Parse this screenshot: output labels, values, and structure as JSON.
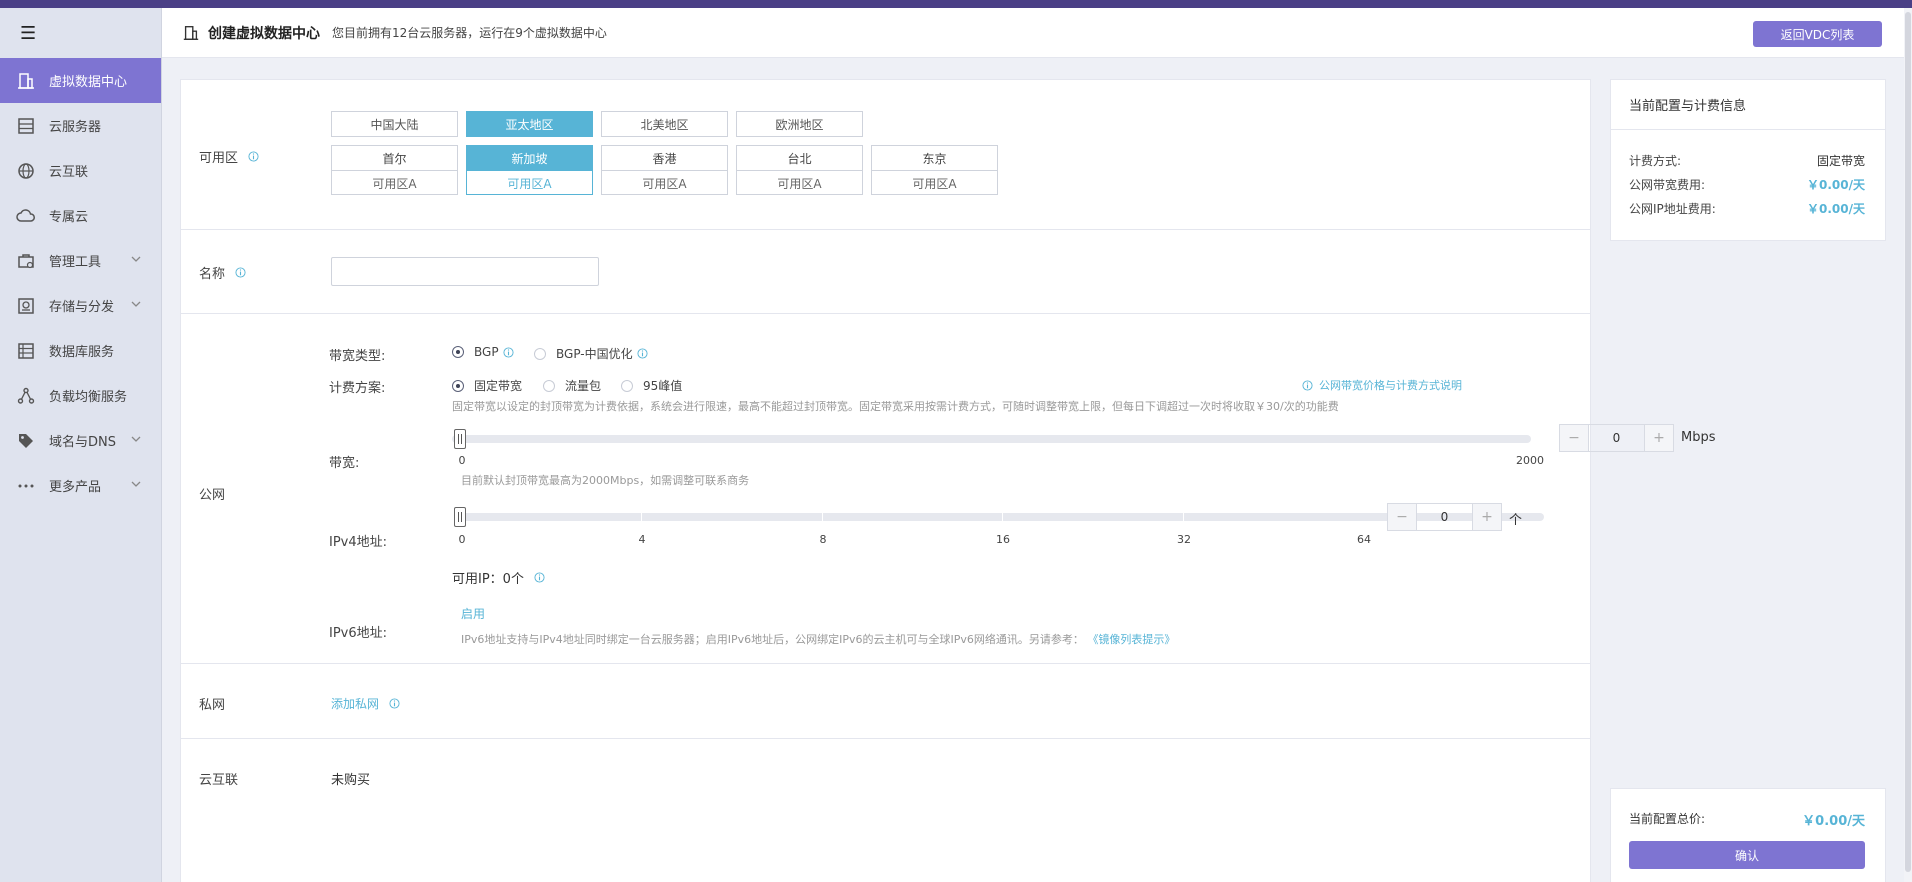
{
  "sidebar": {
    "items": [
      {
        "label": "虚拟数据中心",
        "icon": "building-icon"
      },
      {
        "label": "云服务器",
        "icon": "server-icon"
      },
      {
        "label": "云互联",
        "icon": "globe-icon"
      },
      {
        "label": "专属云",
        "icon": "cloud-icon"
      },
      {
        "label": "管理工具",
        "icon": "toolbox-icon"
      },
      {
        "label": "存储与分发",
        "icon": "storage-icon"
      },
      {
        "label": "数据库服务",
        "icon": "database-icon"
      },
      {
        "label": "负载均衡服务",
        "icon": "network-icon"
      },
      {
        "label": "域名与DNS",
        "icon": "tag-icon"
      },
      {
        "label": "更多产品",
        "icon": "more-icon"
      }
    ]
  },
  "header": {
    "title": "创建虚拟数据中心",
    "subtitle": "您目前拥有12台云服务器，运行在9个虚拟数据中心",
    "back_button": "返回VDC列表"
  },
  "zone": {
    "label": "可用区",
    "regions": [
      "中国大陆",
      "亚太地区",
      "北美地区",
      "欧洲地区"
    ],
    "active_region": "亚太地区",
    "cities": [
      {
        "city": "首尔",
        "az": "可用区A"
      },
      {
        "city": "新加坡",
        "az": "可用区A"
      },
      {
        "city": "香港",
        "az": "可用区A"
      },
      {
        "city": "台北",
        "az": "可用区A"
      },
      {
        "city": "东京",
        "az": "可用区A"
      }
    ],
    "active_city": "新加坡"
  },
  "name_field": {
    "label": "名称",
    "value": ""
  },
  "public_net": {
    "label": "公网",
    "bandwidth_type_label": "带宽类型:",
    "bandwidth_types": [
      "BGP",
      "BGP-中国优化"
    ],
    "billing_label": "计费方案:",
    "billing_options": [
      "固定带宽",
      "流量包",
      "95峰值"
    ],
    "pricing_link": "公网带宽价格与计费方式说明",
    "billing_hint": "固定带宽以设定的封顶带宽为计费依据，系统会进行限速，最高不能超过封顶带宽。固定带宽采用按需计费方式，可随时调整带宽上限，但每日下调超过一次时将收取￥30/次的功能费",
    "bandwidth_label": "带宽:",
    "bandwidth_min": "0",
    "bandwidth_max": "2000",
    "bandwidth_value": "0",
    "bandwidth_unit": "Mbps",
    "bandwidth_hint": "目前默认封顶带宽最高为2000Mbps，如需调整可联系商务",
    "ipv4_label": "IPv4地址:",
    "ipv4_ticks": [
      "0",
      "4",
      "8",
      "16",
      "32",
      "64"
    ],
    "ipv4_value": "0",
    "ipv4_unit": "个",
    "available_ip": "可用IP：0个",
    "ipv6_label": "IPv6地址:",
    "ipv6_enable": "启用",
    "ipv6_hint": "IPv6地址支持与IPv4地址同时绑定一台云服务器；启用IPv6地址后，公网绑定IPv6的云主机可与全球IPv6网络通讯。另请参考：",
    "ipv6_link": "《镜像列表提示》"
  },
  "private_net": {
    "label": "私网",
    "add_link": "添加私网"
  },
  "interconnect": {
    "label": "云互联",
    "value": "未购买"
  },
  "billing_panel": {
    "title": "当前配置与计费信息",
    "rows": [
      {
        "k": "计费方式:",
        "v": "固定带宽"
      },
      {
        "k": "公网带宽费用:",
        "v": "￥0.00/天"
      },
      {
        "k": "公网IP地址费用:",
        "v": "￥0.00/天"
      }
    ]
  },
  "total": {
    "label": "当前配置总价:",
    "value": "￥0.00/天",
    "confirm": "确认"
  },
  "colors": {
    "accent": "#7e74d2",
    "highlight": "#57b4d6",
    "topbar": "#4a3f86"
  }
}
